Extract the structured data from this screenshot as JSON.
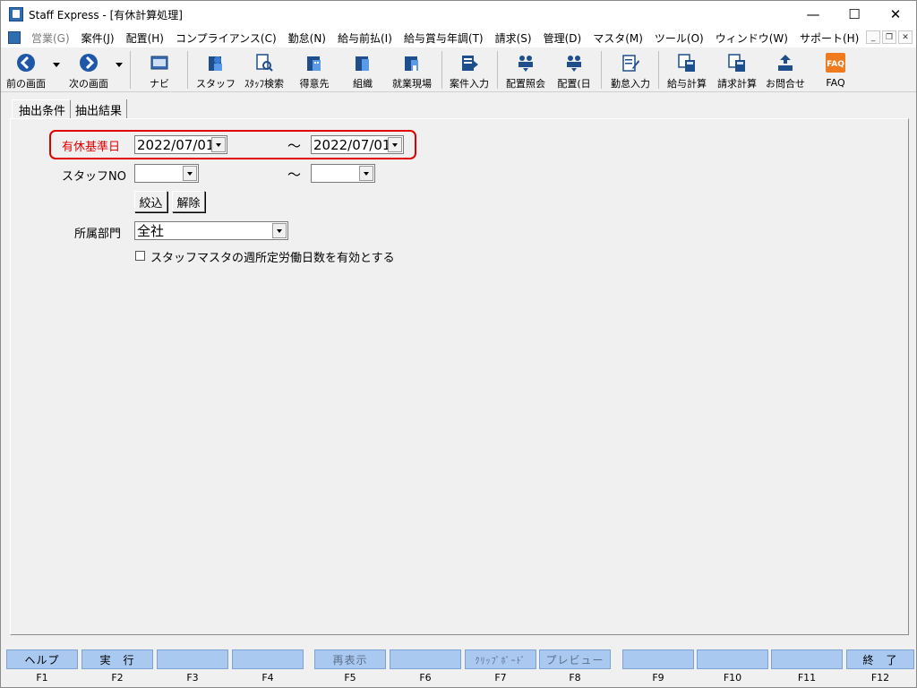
{
  "window": {
    "title": "Staff Express - [有休計算処理]"
  },
  "window_controls": {
    "minimize": "—",
    "maximize": "☐",
    "close": "✕"
  },
  "menu": [
    {
      "label": "営業(G)",
      "enabled": false
    },
    {
      "label": "案件(J)",
      "enabled": true
    },
    {
      "label": "配置(H)",
      "enabled": true
    },
    {
      "label": "コンプライアンス(C)",
      "enabled": true
    },
    {
      "label": "勤怠(N)",
      "enabled": true
    },
    {
      "label": "給与前払(I)",
      "enabled": true
    },
    {
      "label": "給与賞与年調(T)",
      "enabled": true
    },
    {
      "label": "請求(S)",
      "enabled": true
    },
    {
      "label": "管理(D)",
      "enabled": true
    },
    {
      "label": "マスタ(M)",
      "enabled": true
    },
    {
      "label": "ツール(O)",
      "enabled": true
    },
    {
      "label": "ウィンドウ(W)",
      "enabled": true
    },
    {
      "label": "サポート(H)",
      "enabled": true
    }
  ],
  "mdi_controls": {
    "minimize": "_",
    "restore": "❐",
    "close": "✕"
  },
  "toolbar": {
    "back": "前の画面",
    "forward": "次の画面",
    "navi": "ナビ",
    "staff": "スタッフ",
    "staff_search": "ｽﾀｯﾌ検索",
    "client": "得意先",
    "organization": "組織",
    "work_site": "就業現場",
    "case_input": "案件入力",
    "assign_inquiry": "配置照会",
    "assign_day": "配置(日",
    "attendance_input": "勤怠入力",
    "payroll_calc": "給与計算",
    "billing_calc": "請求計算",
    "inquiry": "お問合せ",
    "faq": "FAQ",
    "faq_icon_text": "FAQ"
  },
  "tabs": {
    "conditions": "抽出条件",
    "results": "抽出結果"
  },
  "form": {
    "base_date_label": "有休基準日",
    "base_date_from": "2022/07/01",
    "base_date_to": "2022/07/01",
    "tilde": "～",
    "staff_no_label": "スタッフNO",
    "staff_no_from": "",
    "staff_no_to": "",
    "filter_button": "絞込",
    "clear_button": "解除",
    "department_label": "所属部門",
    "department_value": "全社",
    "checkbox_label": "スタッフマスタの週所定労働日数を有効とする",
    "checkbox_checked": false
  },
  "function_keys": [
    {
      "label": "ヘルプ",
      "key": "F1",
      "enabled": true
    },
    {
      "label": "実　行",
      "key": "F2",
      "enabled": true
    },
    {
      "label": "",
      "key": "F3",
      "enabled": true
    },
    {
      "label": "",
      "key": "F4",
      "enabled": true
    },
    {
      "label": "再表示",
      "key": "F5",
      "enabled": false
    },
    {
      "label": "",
      "key": "F6",
      "enabled": true
    },
    {
      "label": "ｸﾘｯﾌﾟﾎﾞｰﾄﾞ",
      "key": "F7",
      "enabled": false
    },
    {
      "label": "プレビュー",
      "key": "F8",
      "enabled": false
    },
    {
      "label": "",
      "key": "F9",
      "enabled": true
    },
    {
      "label": "",
      "key": "F10",
      "enabled": true
    },
    {
      "label": "",
      "key": "F11",
      "enabled": true
    },
    {
      "label": "終　了",
      "key": "F12",
      "enabled": true
    }
  ],
  "colors": {
    "highlight": "#e00000",
    "fkey": "#a9c9f1",
    "accent": "#2f6db3"
  }
}
